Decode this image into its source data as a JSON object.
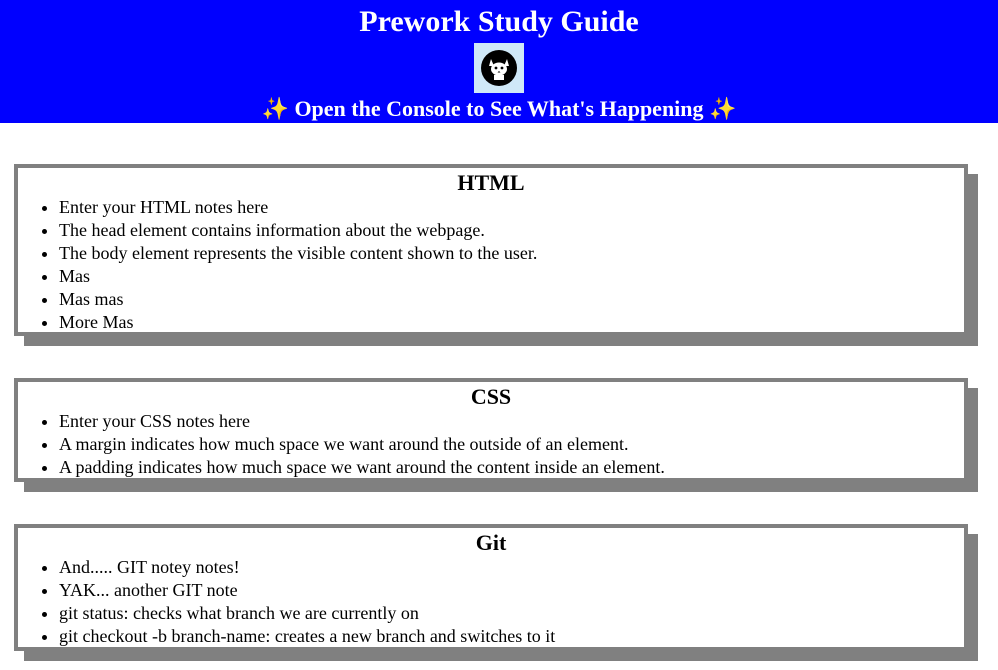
{
  "header": {
    "title": "Prework Study Guide",
    "logo_icon": "cat-logo-icon",
    "subtitle_sparkle_left": "✨",
    "subtitle_text": "Open the Console to See What's Happening",
    "subtitle_sparkle_right": "✨"
  },
  "sections": {
    "html": {
      "heading": "HTML",
      "items": [
        "Enter your HTML notes here",
        "The head element contains information about the webpage.",
        "The body element represents the visible content shown to the user.",
        "Mas",
        "Mas mas",
        "More Mas"
      ]
    },
    "css": {
      "heading": "CSS",
      "items": [
        "Enter your CSS notes here",
        "A margin indicates how much space we want around the outside of an element.",
        "A padding indicates how much space we want around the content inside an element."
      ]
    },
    "git": {
      "heading": "Git",
      "items": [
        "And..... GIT notey notes!",
        "YAK... another GIT note",
        "git status: checks what branch we are currently on",
        "git checkout -b branch-name: creates a new branch and switches to it"
      ]
    }
  },
  "colors": {
    "header_bg": "#0000ff",
    "card_border": "#808080",
    "logo_bg": "#cfe8f8"
  }
}
